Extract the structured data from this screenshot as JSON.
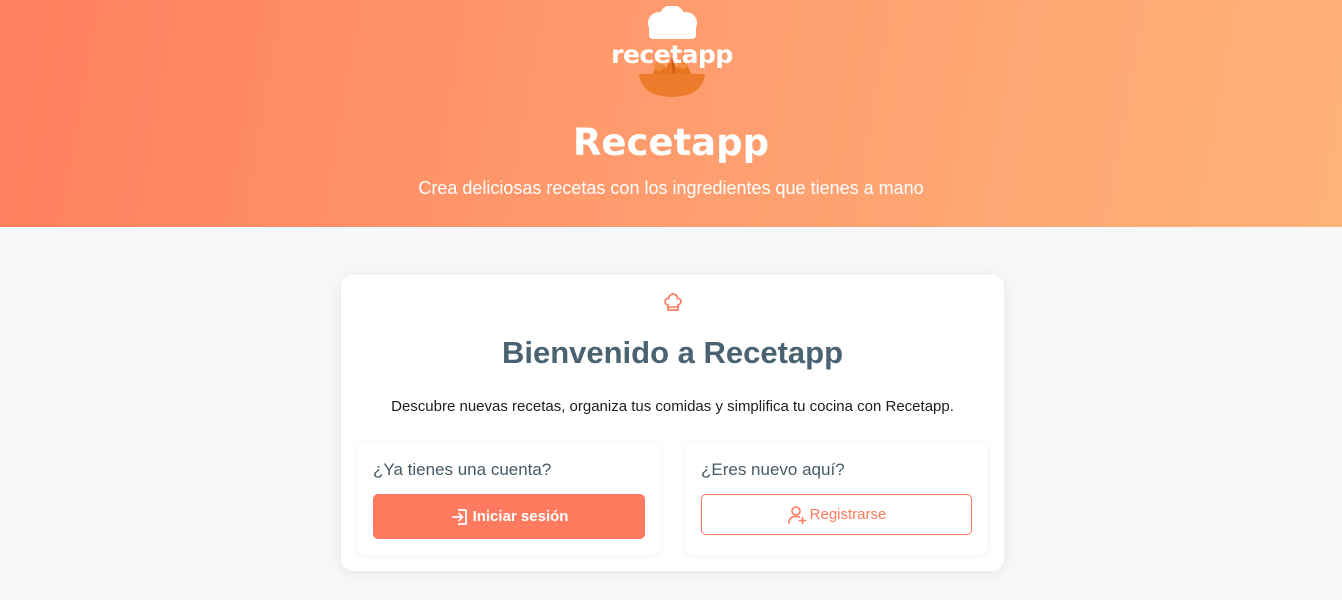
{
  "brand": {
    "logo_text": "recetapp",
    "title": "Recetapp",
    "tagline": "Crea deliciosas recetas con los ingredientes que tienes a mano"
  },
  "colors": {
    "accent": "#ff7a5e",
    "gradient_start": "#ff7f5e",
    "gradient_end": "#ffb27a",
    "heading": "#4a6372"
  },
  "welcome": {
    "icon": "chef-hat-icon",
    "title": "Bienvenido a Recetapp",
    "description": "Descubre nuevas recetas, organiza tus comidas y simplifica tu cocina con Recetapp."
  },
  "login": {
    "prompt": "¿Ya tienes una cuenta?",
    "button_label": "Iniciar sesión",
    "button_icon": "sign-in-icon"
  },
  "register": {
    "prompt": "¿Eres nuevo aquí?",
    "button_label": "Registrarse",
    "button_icon": "user-plus-icon"
  }
}
